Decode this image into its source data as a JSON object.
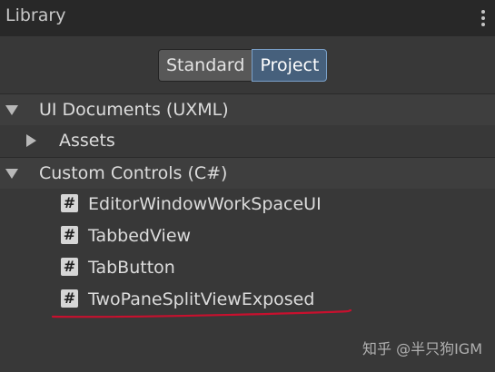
{
  "window": {
    "title": "Library",
    "menu_icon": "kebab-menu-icon"
  },
  "toggle": {
    "options": [
      "Standard",
      "Project"
    ],
    "selected": "Project"
  },
  "tree": {
    "ui_documents": {
      "label": "UI Documents (UXML)",
      "expanded": true,
      "children": {
        "assets": {
          "label": "Assets",
          "expanded": false
        }
      }
    },
    "custom_controls": {
      "label": "Custom Controls (C#)",
      "expanded": true,
      "items": [
        {
          "label": "EditorWindowWorkSpaceUI",
          "icon": "csharp-script-icon"
        },
        {
          "label": "TabbedView",
          "icon": "csharp-script-icon"
        },
        {
          "label": "TabButton",
          "icon": "csharp-script-icon"
        },
        {
          "label": "TwoPaneSplitViewExposed",
          "icon": "csharp-script-icon",
          "underlined": true
        }
      ]
    }
  },
  "icon_glyph": "#",
  "annotation_color": "#c8102e",
  "watermark": "知乎 @半只狗IGM"
}
